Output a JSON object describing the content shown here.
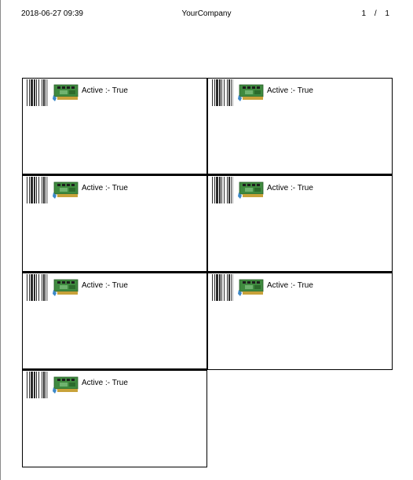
{
  "header": {
    "date": "2018-06-27 09:39",
    "company": "YourCompany",
    "page_info": "1 / 1"
  },
  "cards": [
    {
      "status": "Active :- True",
      "icon": "network-card-icon",
      "barcode": "barcode-icon"
    },
    {
      "status": "Active :- True",
      "icon": "network-card-icon",
      "barcode": "barcode-icon"
    },
    {
      "status": "Active :- True",
      "icon": "network-card-icon",
      "barcode": "barcode-icon"
    },
    {
      "status": "Active :- True",
      "icon": "network-card-icon",
      "barcode": "barcode-icon"
    },
    {
      "status": "Active :- True",
      "icon": "network-card-icon",
      "barcode": "barcode-icon"
    },
    {
      "status": "Active :- True",
      "icon": "network-card-icon",
      "barcode": "barcode-icon"
    },
    {
      "status": "Active :- True",
      "icon": "network-card-icon",
      "barcode": "barcode-icon"
    }
  ],
  "colors": {
    "border": "#000000",
    "card_green": "#3f8a3f",
    "card_gold": "#c8a23a",
    "connector_blue": "#3c88c8"
  }
}
